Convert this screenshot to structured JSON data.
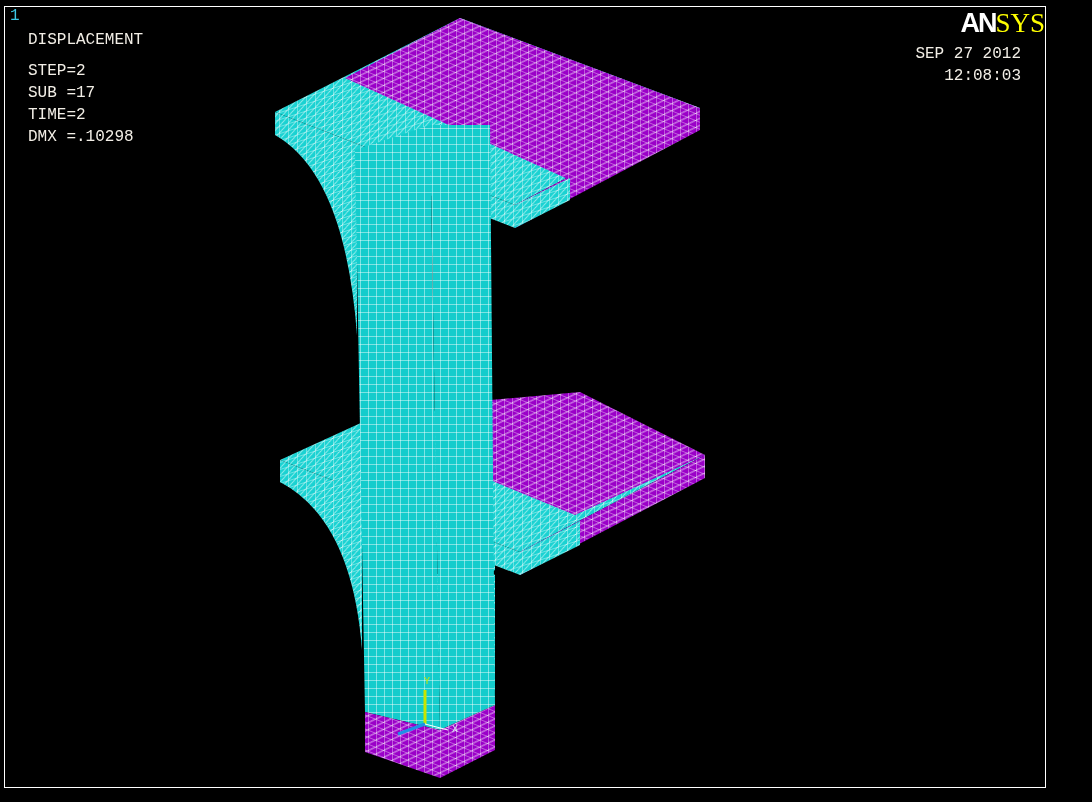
{
  "window_number": "1",
  "plot_title": "DISPLACEMENT",
  "result_lines": [
    "STEP=2",
    "SUB =17",
    "TIME=2",
    "DMX =.10298"
  ],
  "logo": {
    "lead": "AN",
    "accent": "SYS"
  },
  "date": "SEP 27 2012",
  "time": "12:08:03",
  "triad_labels": [
    "Y",
    "X"
  ]
}
